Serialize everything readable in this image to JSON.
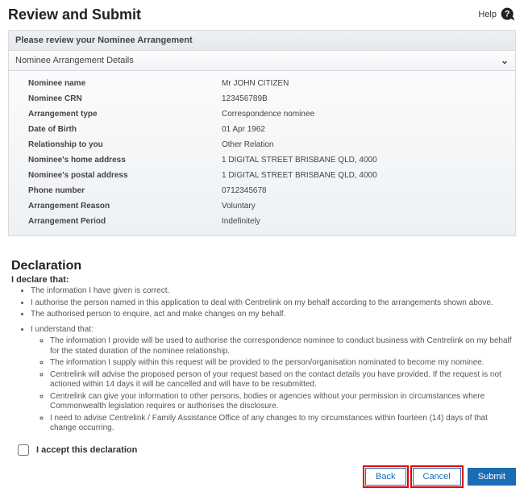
{
  "header": {
    "title": "Review and Submit",
    "help_label": "Help"
  },
  "banner": "Please review your Nominee Arrangement",
  "accordion": {
    "title": "Nominee Arrangement Details"
  },
  "details": [
    {
      "label": "Nominee name",
      "value": "Mr JOHN CITIZEN"
    },
    {
      "label": "Nominee CRN",
      "value": "123456789B"
    },
    {
      "label": "Arrangement type",
      "value": "Correspondence nominee"
    },
    {
      "label": "Date of Birth",
      "value": "01 Apr 1962"
    },
    {
      "label": "Relationship to you",
      "value": "Other Relation"
    },
    {
      "label": "Nominee's home address",
      "value": "1 DIGITAL STREET BRISBANE QLD, 4000"
    },
    {
      "label": "Nominee's postal address",
      "value": "1 DIGITAL STREET BRISBANE QLD, 4000"
    },
    {
      "label": "Phone number",
      "value": "0712345678"
    },
    {
      "label": "Arrangement Reason",
      "value": "Voluntary"
    },
    {
      "label": "Arrangement Period",
      "value": "Indefinitely"
    }
  ],
  "declaration": {
    "title": "Declaration",
    "subheading": "I declare that:",
    "top_bullets": [
      "The information I have given is correct.",
      "I authorise the person named in this application to deal with Centrelink on my behalf according to the arrangements shown above.",
      "The authorised person to enquire, act and make changes on my behalf."
    ],
    "understand_intro": "I understand that:",
    "understand_bullets": [
      "The information I provide will be used to authorise the correspondence nominee to conduct business with Centrelink on my behalf for the stated duration of the nominee relationship.",
      "The information I supply within this request will be provided to the person/organisation nominated to become my nominee.",
      "Centrelink will advise the proposed person of your request based on the contact details you have provided. If the request is not actioned within 14 days it will be cancelled and will have to be resubmitted.",
      "Centrelink can give your information to other persons, bodies or agencies without your permission in circumstances where Commonwealth legislation requires or authorises the disclosure.",
      "I need to advise Centrelink / Family Assistance Office of any changes to my circumstances within fourteen (14) days of that change occurring."
    ],
    "accept_label": "I accept this declaration"
  },
  "buttons": {
    "back": "Back",
    "cancel": "Cancel",
    "submit": "Submit"
  }
}
